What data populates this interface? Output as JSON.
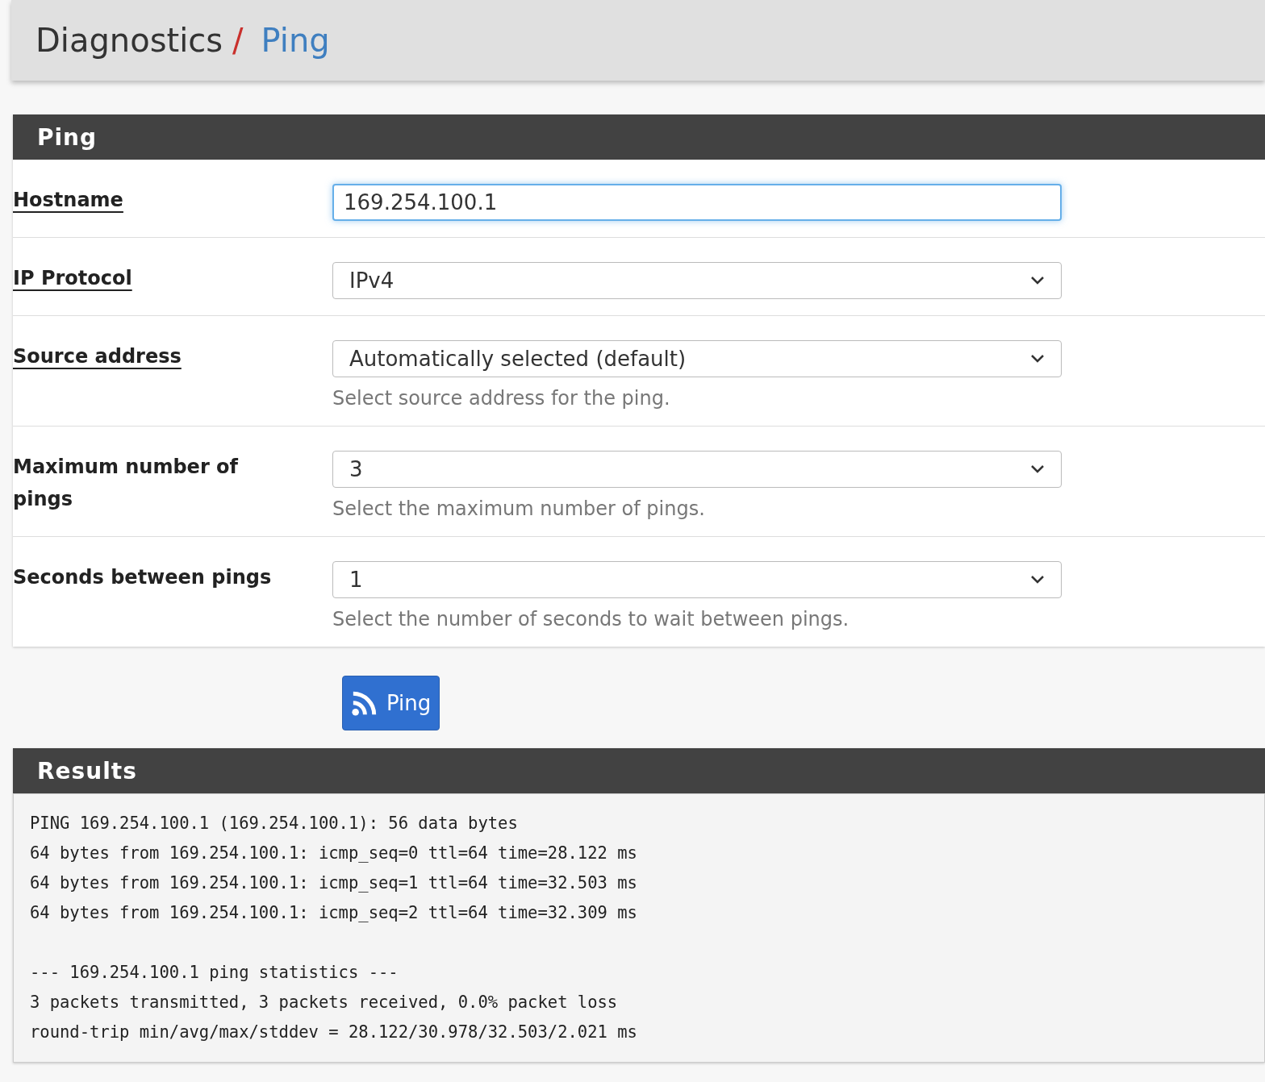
{
  "breadcrumb": {
    "section": "Diagnostics",
    "separator": "/",
    "page": "Ping"
  },
  "form_panel": {
    "title": "Ping",
    "rows": [
      {
        "label": "Hostname",
        "underlined": true,
        "kind": "text",
        "value": "169.254.100.1",
        "focused": true
      },
      {
        "label": "IP Protocol",
        "underlined": true,
        "kind": "select",
        "value": "IPv4"
      },
      {
        "label": "Source address",
        "underlined": true,
        "kind": "select",
        "value": "Automatically selected (default)",
        "help": "Select source address for the ping."
      },
      {
        "label": "Maximum number of pings",
        "underlined": false,
        "kind": "select",
        "value": "3",
        "help": "Select the maximum number of pings."
      },
      {
        "label": "Seconds between pings",
        "underlined": false,
        "kind": "select",
        "value": "1",
        "help": "Select the number of seconds to wait between pings."
      }
    ]
  },
  "ping_button": {
    "label": "Ping"
  },
  "results_panel": {
    "title": "Results",
    "output": "PING 169.254.100.1 (169.254.100.1): 56 data bytes\n64 bytes from 169.254.100.1: icmp_seq=0 ttl=64 time=28.122 ms\n64 bytes from 169.254.100.1: icmp_seq=1 ttl=64 time=32.503 ms\n64 bytes from 169.254.100.1: icmp_seq=2 ttl=64 time=32.309 ms\n\n--- 169.254.100.1 ping statistics ---\n3 packets transmitted, 3 packets received, 0.0% packet loss\nround-trip min/avg/max/stddev = 28.122/30.978/32.503/2.021 ms"
  }
}
